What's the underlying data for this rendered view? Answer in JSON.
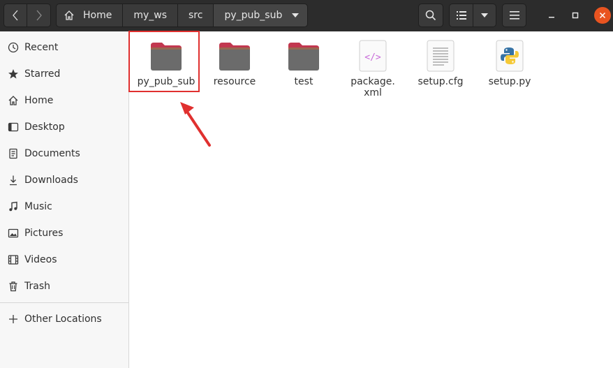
{
  "nav": {
    "back_icon": "chevron-left-icon",
    "forward_icon": "chevron-right-icon"
  },
  "breadcrumb": {
    "home_icon": "home-icon",
    "items": [
      "Home",
      "my_ws",
      "src",
      "py_pub_sub"
    ]
  },
  "toolbar": {
    "search_icon": "search-icon",
    "view_icon": "list-view-icon",
    "view_dropdown_icon": "caret-down-icon",
    "menu_icon": "hamburger-menu-icon"
  },
  "window": {
    "minimize_icon": "minimize-icon",
    "maximize_icon": "maximize-icon",
    "close_icon": "close-icon",
    "close_color": "#e95420"
  },
  "sidebar": {
    "items": [
      {
        "label": "Recent",
        "icon": "clock-icon"
      },
      {
        "label": "Starred",
        "icon": "star-icon"
      },
      {
        "label": "Home",
        "icon": "home-icon"
      },
      {
        "label": "Desktop",
        "icon": "desktop-icon"
      },
      {
        "label": "Documents",
        "icon": "document-icon"
      },
      {
        "label": "Downloads",
        "icon": "download-icon"
      },
      {
        "label": "Music",
        "icon": "music-icon"
      },
      {
        "label": "Pictures",
        "icon": "picture-icon"
      },
      {
        "label": "Videos",
        "icon": "video-icon"
      },
      {
        "label": "Trash",
        "icon": "trash-icon"
      }
    ],
    "other_locations": {
      "label": "Other Locations",
      "icon": "plus-icon"
    }
  },
  "files": [
    {
      "name": "py_pub_sub",
      "type": "folder",
      "highlighted": true
    },
    {
      "name": "resource",
      "type": "folder"
    },
    {
      "name": "test",
      "type": "folder"
    },
    {
      "name": "package.\nxml",
      "type": "xml"
    },
    {
      "name": "setup.cfg",
      "type": "text"
    },
    {
      "name": "setup.py",
      "type": "python"
    }
  ],
  "colors": {
    "header": "#2c2c2c",
    "folder_tab": "#c2374f",
    "folder_body": "#6b6b6b",
    "highlight": "#e0302f",
    "arrow": "#e0302f"
  }
}
